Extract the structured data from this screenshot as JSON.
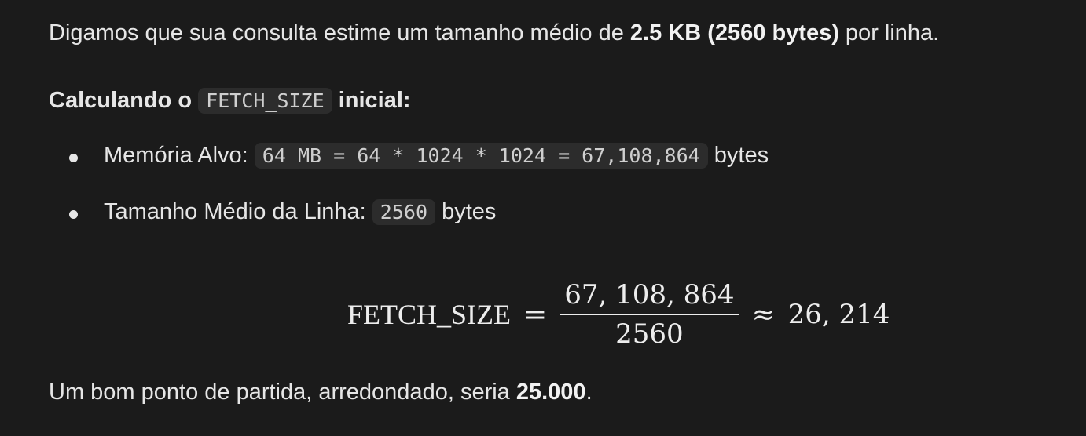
{
  "intro": {
    "prefix": "Digamos que sua consulta estime um tamanho médio de ",
    "bold": "2.5 KB (2560 bytes)",
    "suffix": " por linha."
  },
  "heading": {
    "prefix": "Calculando o ",
    "code": "FETCH_SIZE",
    "suffix": " inicial:"
  },
  "list": [
    {
      "label": "Memória Alvo: ",
      "code": "64 MB = 64 * 1024 * 1024 = 67,108,864",
      "suffix": " bytes"
    },
    {
      "label": "Tamanho Médio da Linha: ",
      "code": "2560",
      "suffix": " bytes"
    }
  ],
  "formula": {
    "lhs": "FETCH_SIZE",
    "eq": "=",
    "numerator": "67, 108, 864",
    "denominator": "2560",
    "approx": "≈",
    "result": "26, 214"
  },
  "outro": {
    "prefix": "Um bom ponto de partida, arredondado, seria ",
    "bold": "25.000",
    "suffix": "."
  }
}
